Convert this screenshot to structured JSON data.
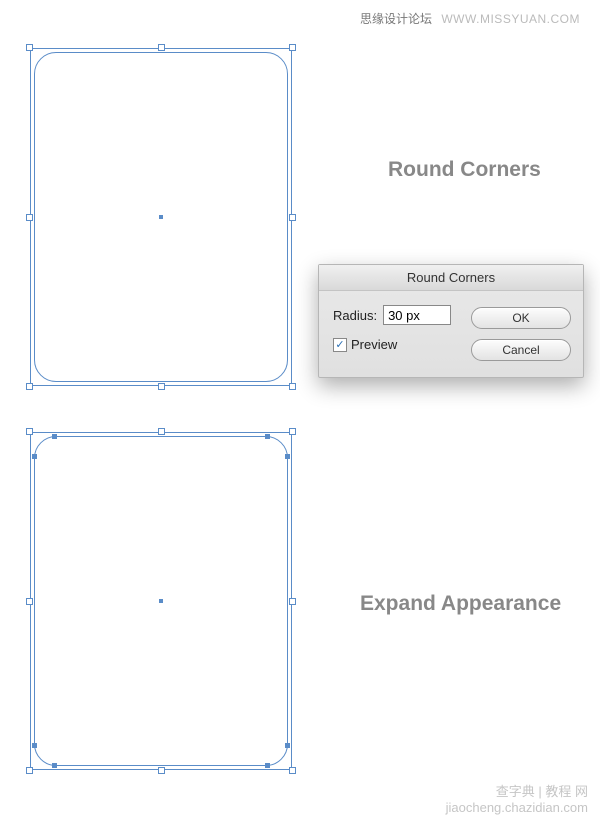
{
  "watermark_top": {
    "chinese": "思缘设计论坛",
    "url": "WWW.MISSYUAN.COM"
  },
  "watermark_bottom": {
    "line1": "查字典 | 教程 网",
    "line2": "jiaocheng.chazidian.com"
  },
  "labels": {
    "round_corners": "Round Corners",
    "expand_appearance": "Expand Appearance"
  },
  "dialog": {
    "title": "Round Corners",
    "radius_label": "Radius:",
    "radius_value": "30 px",
    "preview_label": "Preview",
    "preview_checked": true,
    "ok": "OK",
    "cancel": "Cancel"
  }
}
